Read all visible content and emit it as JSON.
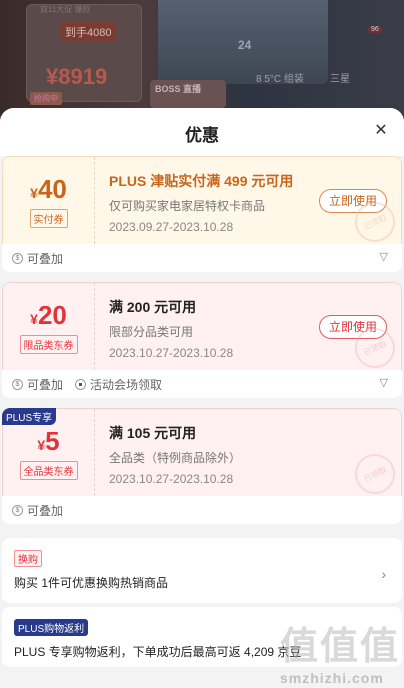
{
  "backdrop": {
    "promo_small": "双11大促 爆款",
    "promo_badge": "到手4080",
    "promo_price": "¥8919",
    "promo_cta": "抢购中",
    "car_number": "24",
    "boss_label": "BOSS 直播",
    "tab_1": "8 5°C 组装",
    "tab_2": "三星",
    "badge_96": "96"
  },
  "sheet": {
    "title": "优惠",
    "close_icon": "close-icon"
  },
  "coupons": [
    {
      "currency": "¥",
      "amount": "40",
      "type": "实付券",
      "title": "PLUS 津贴实付满 499 元可用",
      "desc": "仅可购买家电家居特权卡商品",
      "date": "2023.09.27-2023.10.28",
      "button": "立即使用",
      "stamp": "已领取",
      "foot_1": "可叠加",
      "foot_2": ""
    },
    {
      "currency": "¥",
      "amount": "20",
      "type": "限品类东券",
      "title": "满 200 元可用",
      "desc": "限部分品类可用",
      "date": "2023.10.27-2023.10.28",
      "button": "立即使用",
      "stamp": "已领取",
      "foot_1": "可叠加",
      "foot_2": "活动会场领取"
    },
    {
      "plus_tag": "PLUS专享",
      "currency": "¥",
      "amount": "5",
      "type": "全品类东券",
      "title": "满 105 元可用",
      "desc": "全品类（特例商品除外）",
      "date": "2023.10.27-2023.10.28",
      "stamp": "已领取",
      "foot_1": "可叠加",
      "foot_2": ""
    }
  ],
  "exchange": {
    "tag": "换购",
    "text": "购买 1件可优惠换购热销商品"
  },
  "rebate": {
    "tag": "PLUS购物返利",
    "text": "PLUS 专享购物返利，下单成功后最高可返 4,209 京豆"
  },
  "watermark": {
    "big": "值值值",
    "site": "smzhizhi.com"
  },
  "colors": {
    "gold": "#c8651c",
    "red": "#e3333a",
    "plus_blue": "#2a3a8a"
  }
}
